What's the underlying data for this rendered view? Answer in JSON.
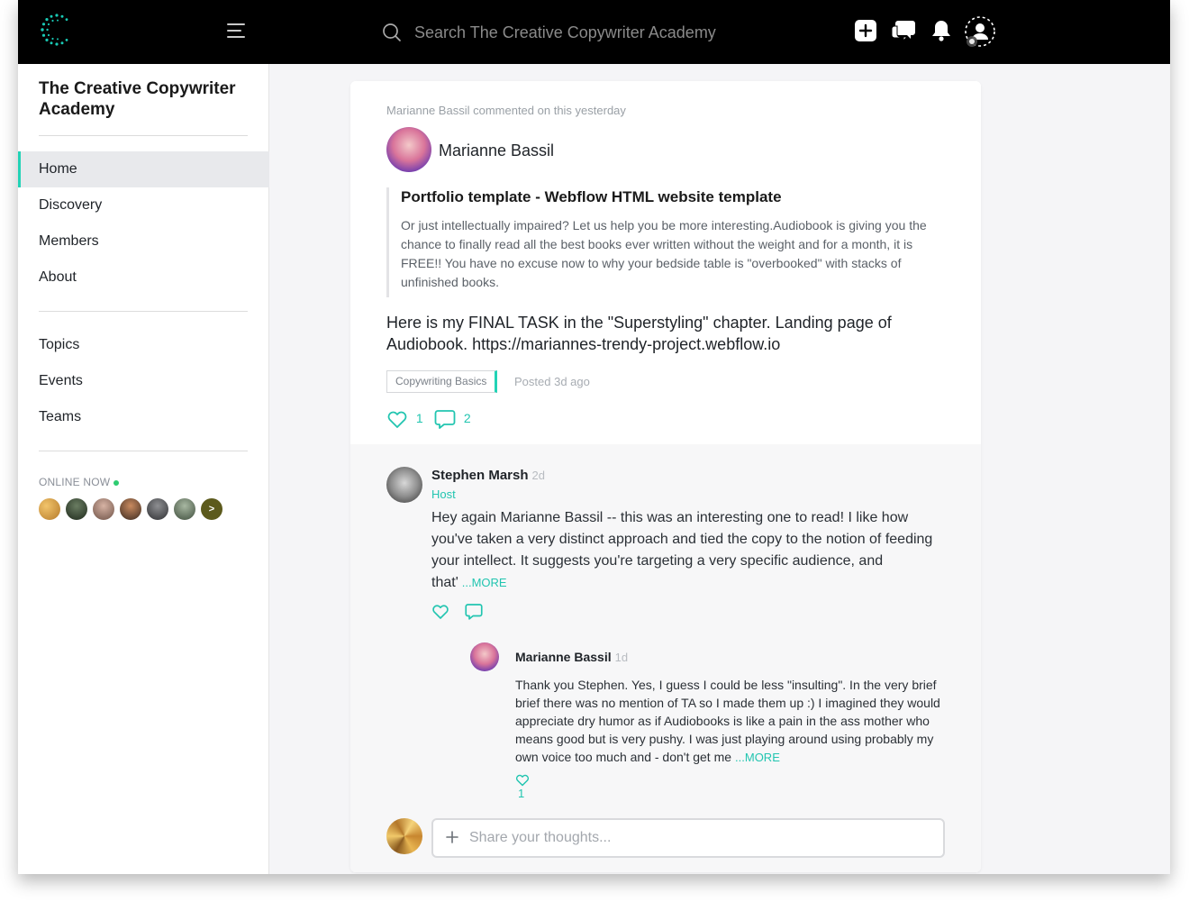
{
  "search": {
    "placeholder": "Search The Creative Copywriter Academy"
  },
  "sidebar": {
    "title": "The Creative Copywriter Academy",
    "primary": [
      {
        "label": "Home",
        "active": true
      },
      {
        "label": "Discovery"
      },
      {
        "label": "Members"
      },
      {
        "label": "About"
      }
    ],
    "secondary": [
      {
        "label": "Topics"
      },
      {
        "label": "Events"
      },
      {
        "label": "Teams"
      }
    ],
    "online_label": "ONLINE NOW",
    "online_more": ">"
  },
  "post": {
    "activity": "Marianne Bassil commented on this yesterday",
    "author": "Marianne Bassil",
    "quote_title": "Portfolio template - Webflow HTML website template",
    "quote_text": "Or just intellectually impaired? Let us help you be more interesting.Audiobook is giving you the chance to finally read all the best books ever written without the weight and for a month, it is FREE!! You have no excuse now to why your bedside table is \"overbooked\" with stacks of unfinished books.",
    "body": "Here is my FINAL TASK in the \"Superstyling\" chapter. Landing page of Audiobook. https://mariannes-trendy-project.webflow.io",
    "tag": "Copywriting Basics",
    "posted": "Posted 3d ago",
    "likes": "1",
    "comments": "2"
  },
  "comment1": {
    "name": "Stephen Marsh",
    "time": "2d",
    "role": "Host",
    "text": "Hey again Marianne Bassil -- this was an interesting one to read! I like how you've taken a very distinct approach and tied the copy to the notion of feeding your intellect. It suggests you're targeting a very specific audience, and that'",
    "more": "...MORE"
  },
  "reply1": {
    "name": "Marianne Bassil",
    "time": "1d",
    "text": "Thank you Stephen. Yes, I guess I could be less \"insulting\". In the very brief brief there was no mention of TA so I made them up :) I imagined they would appreciate dry humor as if Audiobooks is like a pain in the ass mother who means good but is very pushy. I was just playing around using probably my own voice too much and - don't get me",
    "more": "...MORE",
    "likes": "1"
  },
  "share": {
    "placeholder": "Share your thoughts..."
  },
  "colors": {
    "accent": "#22c5b0",
    "topbar": "#000000",
    "active_bar": "#22d3b6"
  }
}
